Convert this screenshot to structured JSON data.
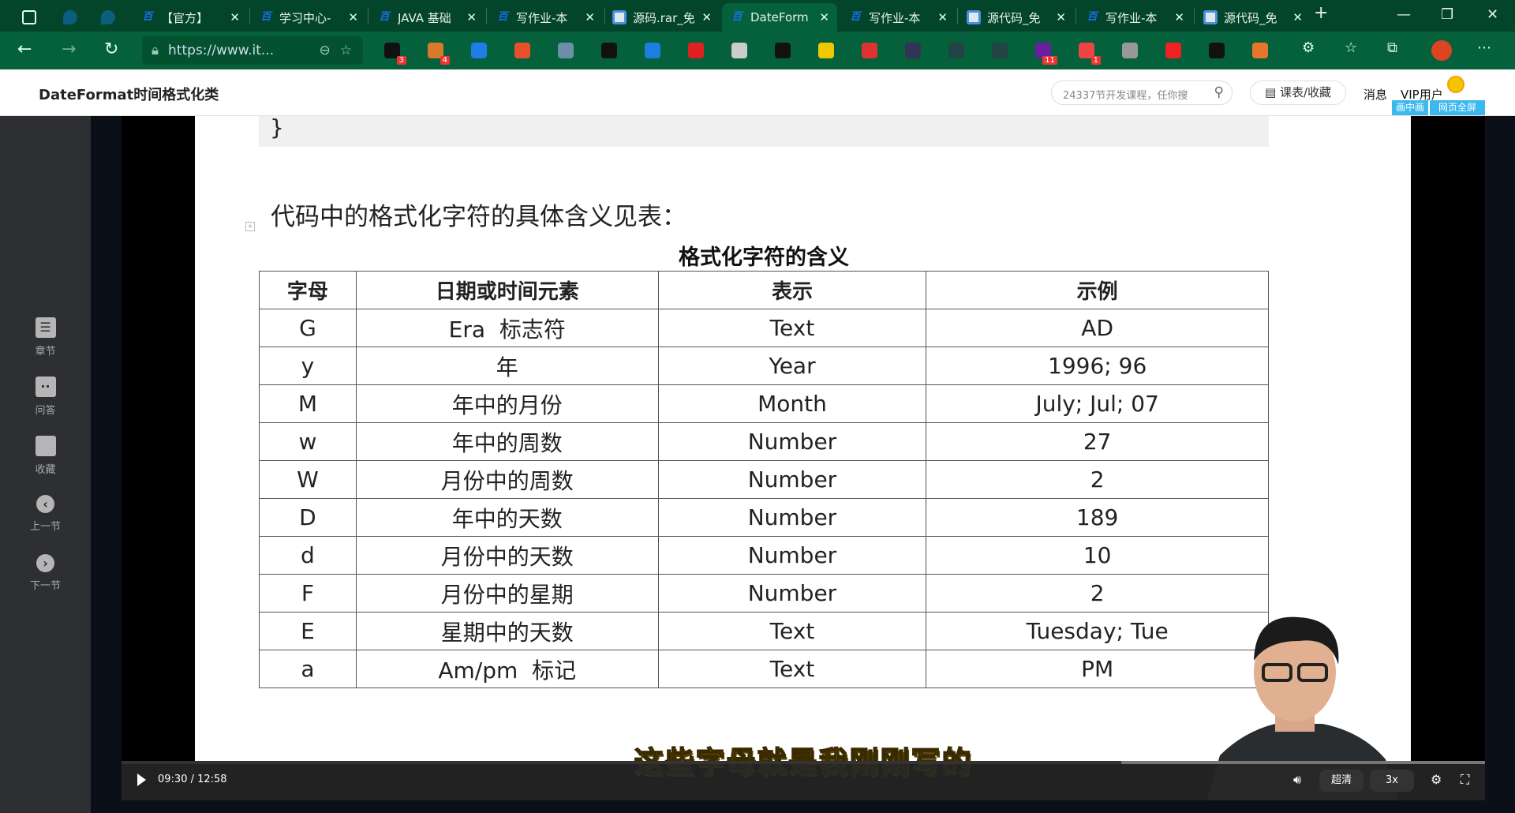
{
  "browser": {
    "tabs": [
      {
        "label": "【官方】",
        "icon": "baidu-icon"
      },
      {
        "label": "学习中心-",
        "icon": "baidu-icon"
      },
      {
        "label": "JAVA 基础",
        "icon": "baidu-icon"
      },
      {
        "label": "写作业-本",
        "icon": "baidu-icon"
      },
      {
        "label": "源码.rar_免",
        "icon": "baidu-netdisk-icon"
      },
      {
        "label": "DateForm",
        "icon": "baidu-icon",
        "active": true
      },
      {
        "label": "写作业-本",
        "icon": "baidu-icon"
      },
      {
        "label": "源代码_免",
        "icon": "netdisk-icon"
      },
      {
        "label": "写作业-本",
        "icon": "baidu-icon"
      },
      {
        "label": "源代码_免",
        "icon": "netdisk-icon"
      }
    ],
    "close_glyph": "✕",
    "new_tab": "+",
    "address": "https://www.it...",
    "ext_badges": [
      "3",
      "4",
      "11",
      "1"
    ]
  },
  "header": {
    "title": "DateFormat时间格式化类",
    "search_placeholder": "24337节开发课程，任你搜",
    "schedule_button": "课表/收藏",
    "messages": "消息",
    "vip": "VIP用户",
    "pip": "画中画",
    "fullpage": "网页全屏"
  },
  "sidebar": {
    "items": [
      {
        "label": "章节",
        "icon": "chapters-icon"
      },
      {
        "label": "问答",
        "icon": "qa-icon"
      },
      {
        "label": "收藏",
        "icon": "bookmark-icon"
      },
      {
        "label": "上一节",
        "icon": "chevron-left-icon"
      },
      {
        "label": "下一节",
        "icon": "chevron-right-icon"
      }
    ]
  },
  "slide": {
    "code_tail": "}",
    "heading": "代码中的格式化字符的具体含义见表：",
    "table_title": "格式化字符的含义",
    "columns": [
      "字母",
      "日期或时间元素",
      "表示",
      "示例"
    ],
    "rows": [
      [
        "G",
        "Era  标志符",
        "Text",
        "AD"
      ],
      [
        "y",
        "年",
        "Year",
        "1996; 96"
      ],
      [
        "M",
        "年中的月份",
        "Month",
        "July; Jul; 07"
      ],
      [
        "w",
        "年中的周数",
        "Number",
        "27"
      ],
      [
        "W",
        "月份中的周数",
        "Number",
        "2"
      ],
      [
        "D",
        "年中的天数",
        "Number",
        "189"
      ],
      [
        "d",
        "月份中的天数",
        "Number",
        "10"
      ],
      [
        "F",
        "月份中的星期",
        "Number",
        "2"
      ],
      [
        "E",
        "星期中的天数",
        "Text",
        "Tuesday; Tue"
      ],
      [
        "a",
        "Am/pm  标记",
        "Text",
        "PM"
      ]
    ]
  },
  "player": {
    "subtitle": "这些字母就是我刚刚写的",
    "time": "09:30 / 12:58",
    "progress": 0.733,
    "quality": "超清",
    "speed": "3x"
  }
}
